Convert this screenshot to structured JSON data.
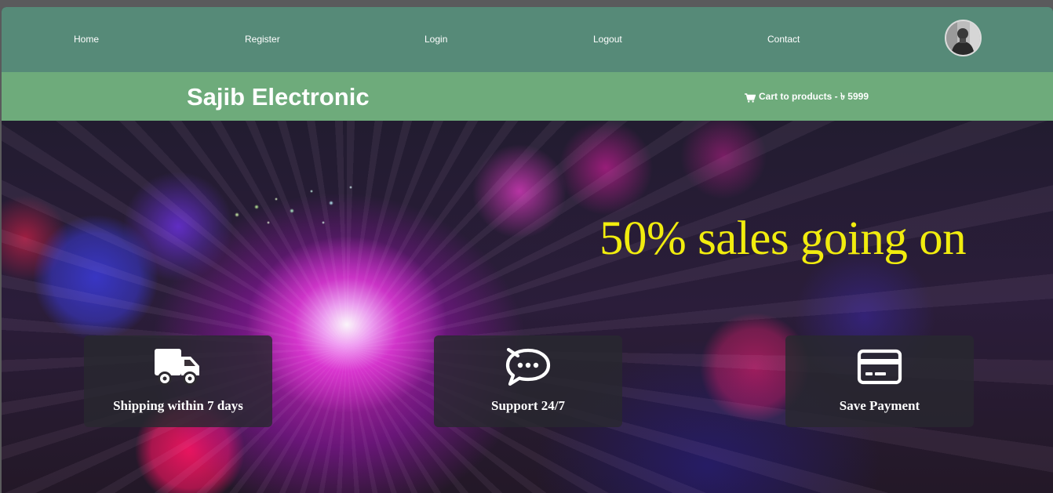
{
  "nav": {
    "items": [
      {
        "label": "Home"
      },
      {
        "label": "Register"
      },
      {
        "label": "Login"
      },
      {
        "label": "Logout"
      },
      {
        "label": "Contact"
      }
    ]
  },
  "brand": {
    "name": "Sajib Electronic",
    "cart_label": "Cart to products - ৳ 5999"
  },
  "hero": {
    "headline": "50% sales going on",
    "headline_color": "#f1ec0e"
  },
  "features": [
    {
      "icon": "truck-icon",
      "label": "Shipping within 7 days"
    },
    {
      "icon": "chat-bubble-icon",
      "label": "Support 24/7"
    },
    {
      "icon": "credit-card-icon",
      "label": "Save Payment"
    }
  ],
  "colors": {
    "nav_bg": "#568a78",
    "brand_bg": "#6eab7b"
  }
}
